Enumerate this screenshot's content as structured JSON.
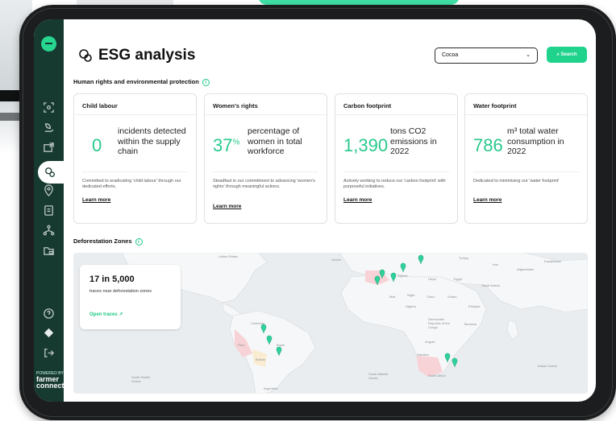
{
  "header": {
    "title": "ESG analysis",
    "select_value": "Cocoa",
    "search_label": "Search"
  },
  "sidebar": {
    "brand_small": "POWERED BY",
    "brand_line1": "farmer",
    "brand_line2": "connect"
  },
  "section_rights": {
    "title": "Human rights and environmental protection"
  },
  "cards": [
    {
      "title": "Child labour",
      "value": "0",
      "unit": "",
      "desc": "incidents detected within the supply chain",
      "note": "Committed to eradicating 'child labour' through our dedicated efforts.",
      "link": "Learn more"
    },
    {
      "title": "Women's rights",
      "value": "37",
      "unit": "%",
      "desc": "percentage of women in total workforce",
      "note": "Steadfast in our commitment to advancing 'women's rights' through meaningful actions.",
      "link": "Learn more"
    },
    {
      "title": "Carbon footprint",
      "value": "1,390",
      "unit": "",
      "desc": "tons CO2 emissions in 2022",
      "note": "Actively working to reduce our 'carbon footprint' with purposeful initiatives.",
      "link": "Learn more"
    },
    {
      "title": "Water footprint",
      "value": "786",
      "unit": "",
      "desc": "m³ total water consumption in 2022",
      "note": "Dedicated to minimising our 'water footprint'",
      "link": "Learn more"
    }
  ],
  "section_deforestation": {
    "title": "Deforestation Zones"
  },
  "map_overlay": {
    "count": "17 in 5,000",
    "subtitle": "traces near deforestation zones",
    "link": "Open traces ↗"
  },
  "map_labels": {
    "usa": "United States",
    "ocean_n": "Ocean",
    "brazil": "Brazil",
    "colombia": "Colombia",
    "peru": "Peru",
    "bolivia": "Bolivia",
    "argentina": "Argentina",
    "spacific": "South Pacific Ocean",
    "satlantic": "South Atlantic Ocean",
    "indian": "Indian Ocean",
    "turkey": "Turkey",
    "iran": "Iran",
    "egypt": "Egypt",
    "libya": "Libya",
    "algeria": "Algeria",
    "mali": "Mali",
    "niger": "Niger",
    "chad": "Chad",
    "sudan": "Sudan",
    "ethiopia": "Ethiopia",
    "nigeria": "Nigeria",
    "drc": "Democratic Republic of the Congo",
    "angola": "Angola",
    "tanzania": "Tanzania",
    "southafrica": "South Africa",
    "namibia": "Namibia",
    "saudi": "Saudi Arabia",
    "afghanistan": "Afghanistan",
    "kazakhstan": "Kazakhstan"
  },
  "colors": {
    "accent": "#1fd38c",
    "sidebar": "#173a30",
    "value": "#29c98c"
  }
}
